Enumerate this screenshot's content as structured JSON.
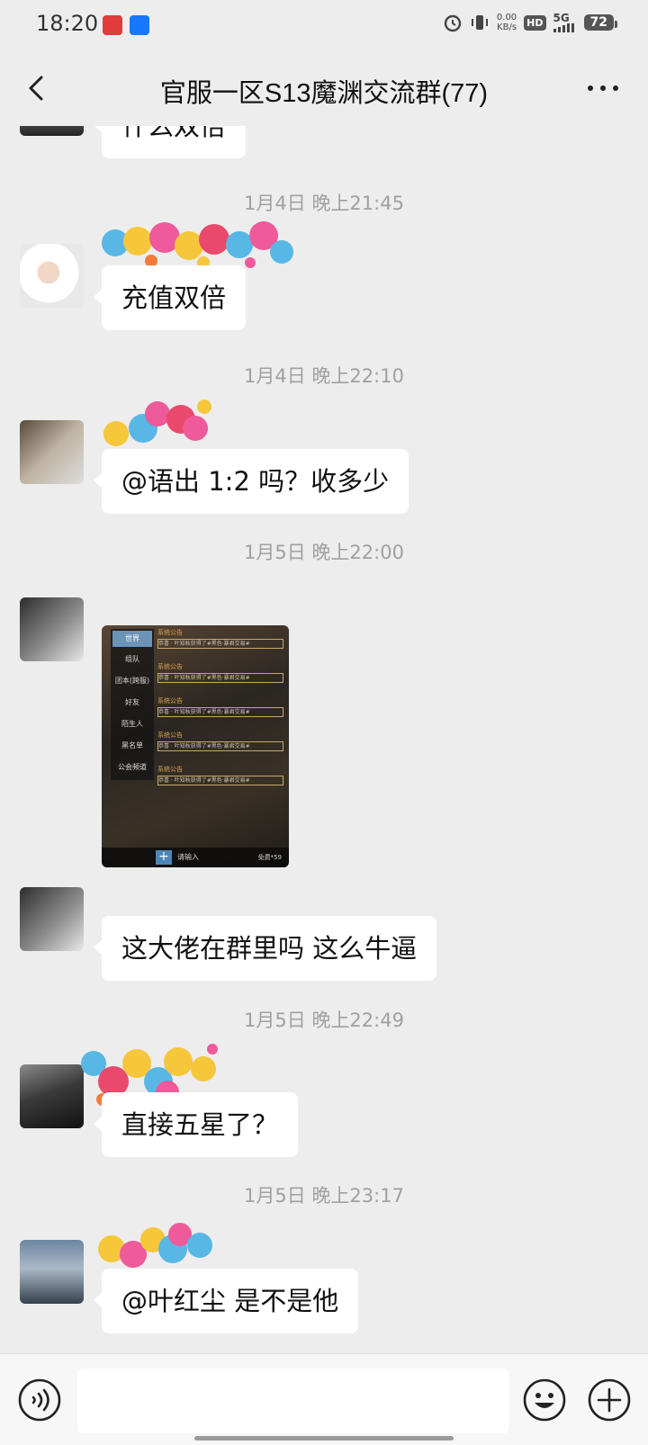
{
  "status_bar": {
    "time": "18:20",
    "net_speed_value": "0.00",
    "net_speed_unit": "KB/s",
    "hd": "HD",
    "network": "5G",
    "battery": "72"
  },
  "header": {
    "title": "官服一区S13魔渊交流群(77)",
    "back_icon": "back-arrow-icon",
    "more_icon": "more-dots-icon"
  },
  "messages": [
    {
      "text": "什么双倍"
    },
    {
      "timestamp": "1月4日 晚上21:45",
      "text": "充值双倍"
    },
    {
      "timestamp": "1月4日 晚上22:10",
      "text": "@语出  1:2 吗？收多少"
    },
    {
      "timestamp": "1月5日 晚上22:00",
      "image": {
        "tabs": [
          "世界",
          "组队",
          "团本(跨服)",
          "好友",
          "陌生人",
          "黑名单",
          "公会频道"
        ],
        "announcement_title": "系统公告",
        "announcement_text": "恭喜 · 叶知秋获得了#黑色·暴君交易#",
        "input_placeholder": "请输入",
        "free_label": "免费*59"
      }
    },
    {
      "text": "这大佬在群里吗  这么牛逼"
    },
    {
      "timestamp": "1月5日 晚上22:49",
      "text": "直接五星了？"
    },
    {
      "timestamp": "1月5日 晚上23:17",
      "text": "@叶红尘  是不是他"
    }
  ],
  "input_bar": {
    "voice_icon": "voice-icon",
    "emoji_icon": "emoji-icon",
    "plus_icon": "plus-icon",
    "input_value": ""
  }
}
